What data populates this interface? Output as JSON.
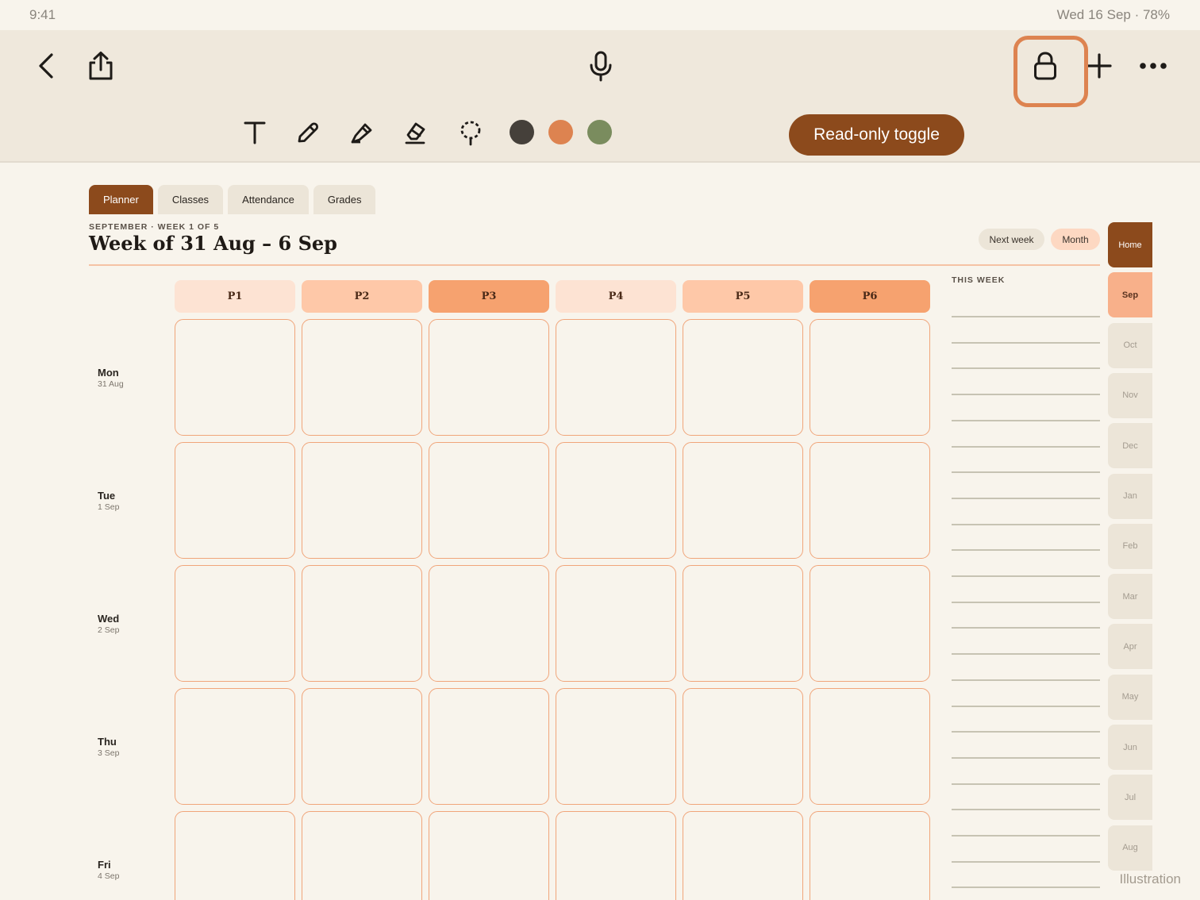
{
  "status_bar": {
    "time": "9:41",
    "right": "Wed 16 Sep · 78%"
  },
  "toolbar": {
    "icons": [
      "chevron-left-icon",
      "share-icon",
      "microphone-icon",
      "lock-icon",
      "plus-icon",
      "more-icon"
    ],
    "tools": [
      "text-tool-icon",
      "pen-tool-icon",
      "highlighter-tool-icon",
      "eraser-tool-icon",
      "lasso-tool-icon"
    ],
    "colors": [
      "#45403a",
      "#dd8350",
      "#7a8c5e"
    ],
    "readonly_label": "Read-only toggle"
  },
  "tabs": [
    {
      "label": "Planner",
      "active": true
    },
    {
      "label": "Classes",
      "active": false
    },
    {
      "label": "Attendance",
      "active": false
    },
    {
      "label": "Grades",
      "active": false
    }
  ],
  "header": {
    "subtitle": "SEPTEMBER · WEEK 1 OF 5",
    "title": "Week of 31 Aug – 6 Sep",
    "next_week": "Next week",
    "month": "Month"
  },
  "periods": [
    {
      "label": "P1",
      "color": "#fde3d3"
    },
    {
      "label": "P2",
      "color": "#fec8a8"
    },
    {
      "label": "P3",
      "color": "#f6a26f"
    },
    {
      "label": "P4",
      "color": "#fde3d3"
    },
    {
      "label": "P5",
      "color": "#fec8a8"
    },
    {
      "label": "P6",
      "color": "#f6a26f"
    }
  ],
  "days": [
    {
      "name": "Mon",
      "date": "31 Aug"
    },
    {
      "name": "Tue",
      "date": "1 Sep"
    },
    {
      "name": "Wed",
      "date": "2 Sep"
    },
    {
      "name": "Thu",
      "date": "3 Sep"
    },
    {
      "name": "Fri",
      "date": "4 Sep"
    }
  ],
  "this_week_label": "THIS WEEK",
  "month_tabs": [
    {
      "label": "Home",
      "state": "home"
    },
    {
      "label": "Sep",
      "state": "current"
    },
    {
      "label": "Oct",
      "state": ""
    },
    {
      "label": "Nov",
      "state": ""
    },
    {
      "label": "Dec",
      "state": ""
    },
    {
      "label": "Jan",
      "state": ""
    },
    {
      "label": "Feb",
      "state": ""
    },
    {
      "label": "Mar",
      "state": ""
    },
    {
      "label": "Apr",
      "state": ""
    },
    {
      "label": "May",
      "state": ""
    },
    {
      "label": "Jun",
      "state": ""
    },
    {
      "label": "Jul",
      "state": ""
    },
    {
      "label": "Aug",
      "state": ""
    }
  ],
  "footer_label": "Illustration"
}
